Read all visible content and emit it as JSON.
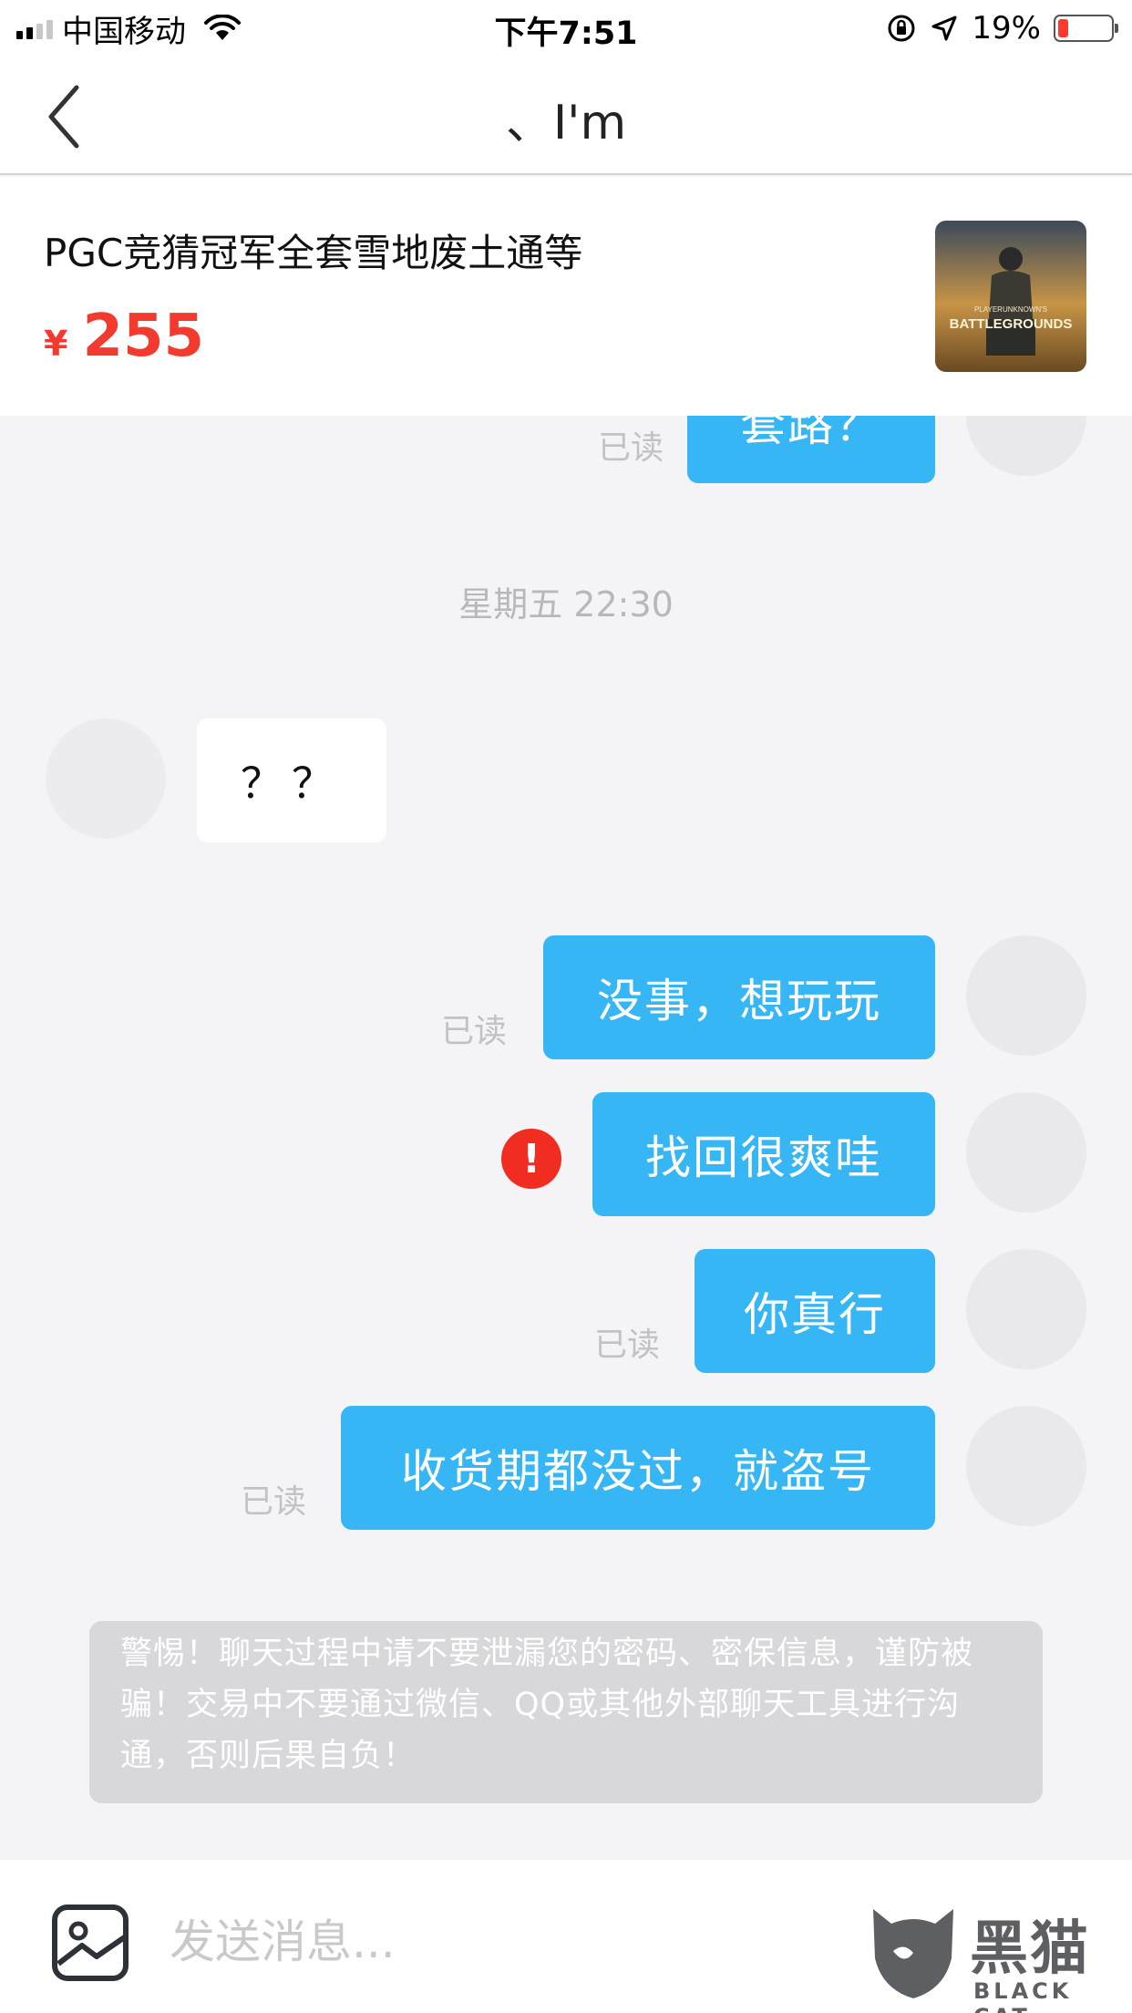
{
  "status_bar": {
    "carrier": "中国移动",
    "time": "下午7:51",
    "battery": "19%",
    "battery_level": 0.19
  },
  "nav": {
    "title": "、I'm"
  },
  "product": {
    "title": "PGC竞猜冠军全套雪地废土通等",
    "currency": "¥",
    "price": "255",
    "thumbnail_text_top": "PLAYERUNKNOWN'S",
    "thumbnail_text_main": "BATTLEGROUNDS"
  },
  "chat": {
    "top_partial_message": "套路？",
    "top_partial_status": "已读",
    "timestamp": "星期五 22:30",
    "incoming_message": "？？",
    "messages": [
      {
        "text": "没事，想玩玩",
        "status": "已读"
      },
      {
        "text": "找回很爽哇",
        "status": "!"
      },
      {
        "text": "你真行",
        "status": "已读"
      },
      {
        "text": "收货期都没过，就盗号",
        "status": "已读"
      }
    ],
    "warning": "警惕！聊天过程中请不要泄漏您的密码、密保信息，谨防被骗！交易中不要通过微信、QQ或其他外部聊天工具进行沟通，否则后果自负！"
  },
  "input": {
    "placeholder": "发送消息..."
  },
  "watermark": {
    "cn": "黑猫",
    "en": "BLACK CAT"
  },
  "colors": {
    "bubble_me": "#37b6f6",
    "price": "#f23a2f",
    "error": "#f12d22"
  }
}
